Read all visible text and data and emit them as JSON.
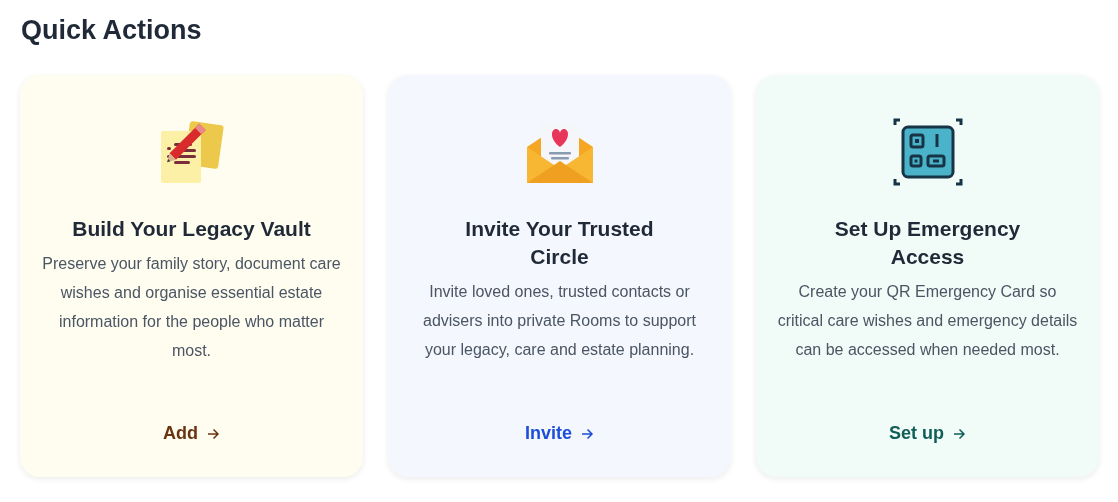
{
  "heading": "Quick Actions",
  "cards": [
    {
      "kind": "vault",
      "title": "Build Your Legacy Vault",
      "description": "Preserve your family story, document care wishes and organise essential estate information for the people who matter most.",
      "action": "Add"
    },
    {
      "kind": "invite",
      "title": "Invite Your Trusted Circle",
      "description": "Invite loved ones, trusted contacts or advisers into private Rooms to support your legacy, care and estate planning.",
      "action": "Invite"
    },
    {
      "kind": "emergency",
      "title": "Set Up Emergency Access",
      "description": "Create your QR Emergency Card so critical care wishes and emergency details can be accessed when needed most.",
      "action": "Set up"
    }
  ]
}
